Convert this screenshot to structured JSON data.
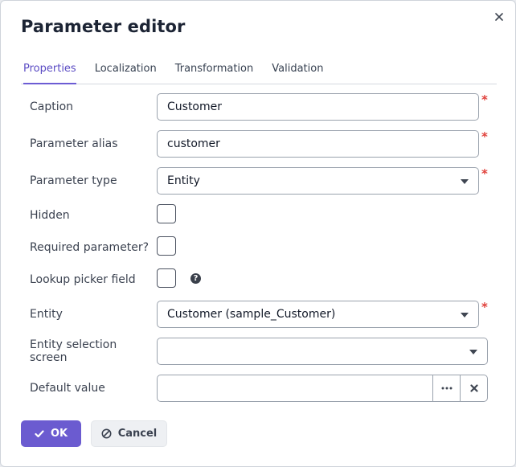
{
  "dialog": {
    "title": "Parameter editor",
    "close_icon": "close-icon"
  },
  "tabs": [
    {
      "label": "Properties",
      "active": true
    },
    {
      "label": "Localization",
      "active": false
    },
    {
      "label": "Transformation",
      "active": false
    },
    {
      "label": "Validation",
      "active": false
    }
  ],
  "form": {
    "caption": {
      "label": "Caption",
      "value": "Customer",
      "required": true
    },
    "alias": {
      "label": "Parameter alias",
      "value": "customer",
      "required": true
    },
    "type": {
      "label": "Parameter type",
      "value": "Entity",
      "required": true
    },
    "hidden": {
      "label": "Hidden",
      "checked": false
    },
    "required_param": {
      "label": "Required parameter?",
      "checked": false
    },
    "lookup": {
      "label": "Lookup picker field",
      "checked": false,
      "help_icon": "question-circle-icon"
    },
    "entity": {
      "label": "Entity",
      "value": "Customer (sample_Customer)",
      "required": true
    },
    "entity_screen": {
      "label": "Entity selection screen",
      "value": ""
    },
    "default_value": {
      "label": "Default value",
      "value": ""
    }
  },
  "required_marker": "*",
  "buttons": {
    "ok": "OK",
    "cancel": "Cancel"
  },
  "colors": {
    "accent": "#6b5bd0",
    "required": "#e0403a"
  }
}
